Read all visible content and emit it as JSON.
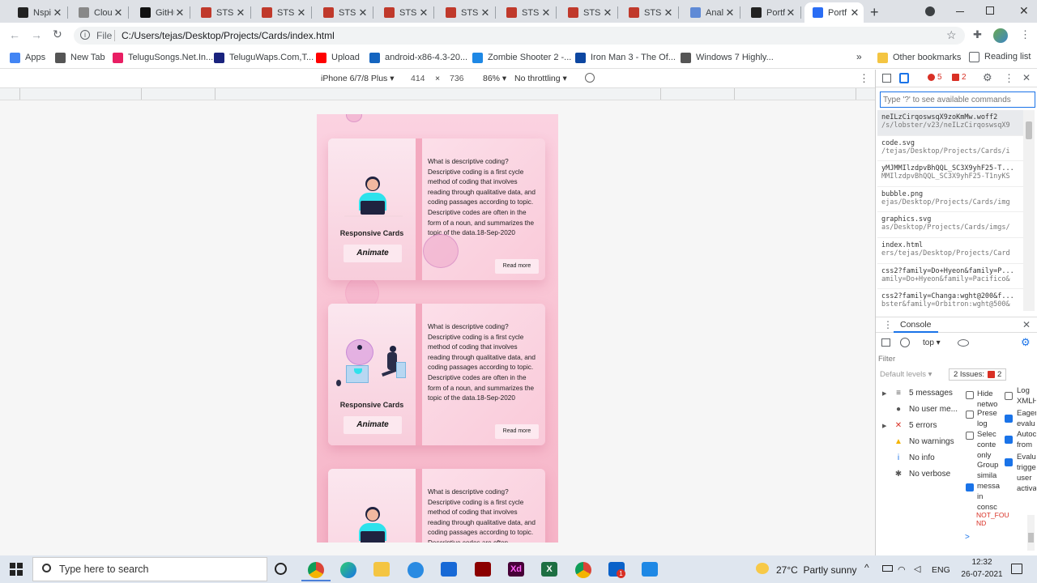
{
  "browser": {
    "tabs": [
      {
        "title": "Nspi",
        "color": "#222"
      },
      {
        "title": "Cloud",
        "color": "#888"
      },
      {
        "title": "GitHu",
        "color": "#111"
      },
      {
        "title": "STS |",
        "color": "#c0392b"
      },
      {
        "title": "STS |",
        "color": "#c0392b"
      },
      {
        "title": "STS |",
        "color": "#c0392b"
      },
      {
        "title": "STS |",
        "color": "#c0392b"
      },
      {
        "title": "STS |",
        "color": "#c0392b"
      },
      {
        "title": "STS |",
        "color": "#c0392b"
      },
      {
        "title": "STS |",
        "color": "#c0392b"
      },
      {
        "title": "STS |",
        "color": "#c0392b"
      },
      {
        "title": "Anal",
        "color": "#5f8ad6"
      },
      {
        "title": "Portf",
        "color": "#222"
      },
      {
        "title": "Portf",
        "color": "#2a6df4"
      }
    ],
    "tab_close": "✕",
    "new_tab": "+",
    "address_prefix": "File",
    "address": "C:/Users/tejas/Desktop/Projects/Cards/index.html",
    "bookmarks": [
      {
        "label": "Apps",
        "color": "#4285f4"
      },
      {
        "label": "New Tab",
        "color": "#555"
      },
      {
        "label": "TeluguSongs.Net.In...",
        "color": "#e91e63"
      },
      {
        "label": "TeluguWaps.Com,T...",
        "color": "#1a237e"
      },
      {
        "label": "Upload",
        "color": "#ff0000"
      },
      {
        "label": "android-x86-4.3-20...",
        "color": "#1565c0"
      },
      {
        "label": "Zombie Shooter 2 -...",
        "color": "#1e88e5"
      },
      {
        "label": "Iron Man 3 - The Of...",
        "color": "#0d47a1"
      },
      {
        "label": "Windows 7 Highly...",
        "color": "#555"
      }
    ],
    "bookmarks_more": "»",
    "other_bookmarks": "Other bookmarks",
    "reading_list": "Reading list"
  },
  "device_toolbar": {
    "device": "iPhone 6/7/8 Plus",
    "width": "414",
    "times": "×",
    "height": "736",
    "zoom": "86%",
    "throttle": "No throttling"
  },
  "cards": [
    {
      "title": "Responsive Cards",
      "button": "Animate",
      "text": "What is descriptive coding? Descriptive coding is a first cycle method of coding that involves reading through qualitative data, and coding passages according to topic. Descriptive codes are often in the form of a noun, and summarizes the topic of the data.18-Sep-2020",
      "more": "Read more"
    },
    {
      "title": "Responsive Cards",
      "button": "Animate",
      "text": "What is descriptive coding? Descriptive coding is a first cycle method of coding that involves reading through qualitative data, and coding passages according to topic. Descriptive codes are often in the form of a noun, and summarizes the topic of the data.18-Sep-2020",
      "more": "Read more"
    },
    {
      "title": "Responsive Cards",
      "button": "Animate",
      "text": "What is descriptive coding? Descriptive coding is a first cycle method of coding that involves reading through qualitative data, and coding passages according to topic. Descriptive codes are often",
      "more": "Read more"
    }
  ],
  "devtools": {
    "error_count": "5",
    "issue_count": "2",
    "command_placeholder": "Type '?' to see available commands",
    "command_items": [
      {
        "a": "neILzCirqoswsqX9zoKmMw.woff2",
        "b": "/s/lobster/v23/neILzCirqoswsqX9"
      },
      {
        "a": "code.svg",
        "b": "/tejas/Desktop/Projects/Cards/i"
      },
      {
        "a": "yMJMMIlzdpvBhQQL_SC3X9yhF25-T...",
        "b": "MMIlzdpvBhQQL_SC3X9yhF25-T1nyKS"
      },
      {
        "a": "bubble.png",
        "b": "ejas/Desktop/Projects/Cards/img"
      },
      {
        "a": "graphics.svg",
        "b": "as/Desktop/Projects/Cards/imgs/"
      },
      {
        "a": "index.html",
        "b": "ers/tejas/Desktop/Projects/Card"
      },
      {
        "a": "css2?family=Do+Hyeon&family=P...",
        "b": "amily=Do+Hyeon&family=Pacifico&"
      },
      {
        "a": "css2?family=Changa:wght@200&f...",
        "b": "bster&family=Orbitron:wght@500&"
      }
    ],
    "console_tab": "Console",
    "context": "top",
    "filter_placeholder": "Filter",
    "default_levels": "Default levels",
    "issues_label": "2 Issues:",
    "issues_count": "2",
    "sidebar": [
      {
        "label": "5 messages",
        "icon": "≡"
      },
      {
        "label": "No user me...",
        "icon": "●"
      },
      {
        "label": "5 errors",
        "icon": "✕"
      },
      {
        "label": "No warnings",
        "icon": "▲"
      },
      {
        "label": "No info",
        "icon": "i"
      },
      {
        "label": "No verbose",
        "icon": "✱"
      }
    ],
    "options_left": [
      "Hide netwo",
      "Prese log",
      "Selec conte only",
      "Group simila messa in consc"
    ],
    "options_right": [
      "Log XMLH",
      "Eager evalu",
      "Autoc from",
      "Evalua trigge user activa"
    ],
    "error_text": "NOT_FOU ND",
    "prompt": ">"
  },
  "taskbar": {
    "search_placeholder": "Type here to search",
    "weather": "27°C  Partly sunny",
    "lang": "ENG",
    "time": "12:32",
    "date": "26-07-2021",
    "notification_count": "1"
  }
}
